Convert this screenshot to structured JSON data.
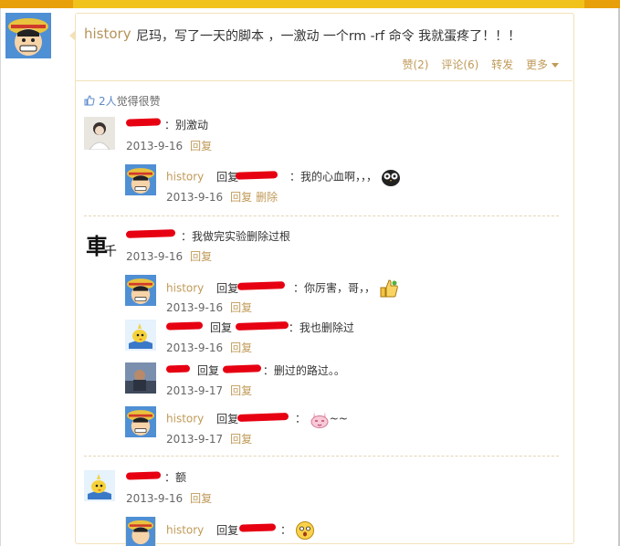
{
  "post": {
    "author": "history",
    "text": "尼玛，写了一天的脚本 ，一激动 一个rm -rf 命令 我就蛋疼了！！！",
    "actions": {
      "like": "赞(2)",
      "comment": "评论(6)",
      "forward": "转发",
      "more": "更多"
    }
  },
  "likes": {
    "count": "2人",
    "suffix": "觉得很赞"
  },
  "comments": [
    {
      "text": "：别激动",
      "date": "2013-9-16",
      "reply": "回复"
    },
    {
      "author": "history",
      "reply_word": "回复",
      "text": "：我的心血啊，，，",
      "date": "2013-9-16",
      "reply": "回复",
      "delete": "删除"
    },
    {
      "text": "：我做完实验删除过根",
      "date": "2013-9-16",
      "reply": "回复"
    },
    {
      "author": "history",
      "reply_word": "回复",
      "text": "：你厉害，哥，，",
      "date": "2013-9-16",
      "reply": "回复"
    },
    {
      "reply_word": "回复",
      "text": "：我也删除过",
      "date": "2013-9-16",
      "reply": "回复"
    },
    {
      "reply_word": "回复",
      "text": "：删过的路过。。",
      "date": "2013-9-17",
      "reply": "回复"
    },
    {
      "author": "history",
      "reply_word": "回复",
      "text": "~~",
      "date": "2013-9-17",
      "reply": "回复"
    },
    {
      "text": "：额",
      "date": "2013-9-16",
      "reply": "回复"
    },
    {
      "author": "history",
      "reply_word": "回复",
      "text": "："
    }
  ],
  "icons": [
    "luffy-avatar-icon",
    "thumbs-up-icon",
    "owl-emoji-icon",
    "thumbs-up-emoji-icon",
    "bunny-emoji-icon",
    "surprised-emoji-icon",
    "bird-avatar-icon",
    "chinese-character-avatar-icon"
  ],
  "colors": {
    "brand_bar": "#e8a00a",
    "link": "#c09a58",
    "redaction": "#e60012",
    "like_blue": "#5b8ac9"
  }
}
